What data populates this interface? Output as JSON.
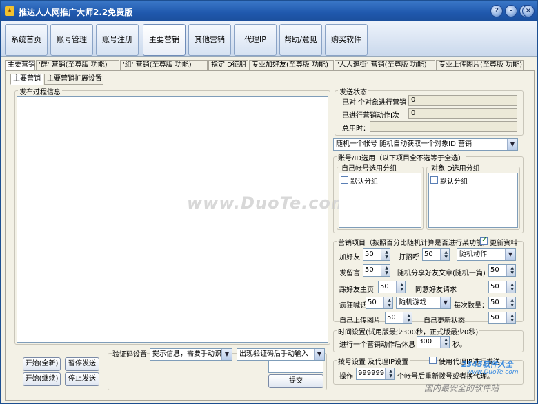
{
  "window": {
    "title": "推达人人网推广大师2.2免费版",
    "icon": "app-icon"
  },
  "window_buttons": [
    "help-icon",
    "minimize-icon",
    "maximize-icon",
    "close-icon"
  ],
  "nav": [
    "系统首页",
    "账号管理",
    "账号注册",
    "主要营销",
    "其他营销",
    "代理IP",
    "帮助/意见",
    "购买软件"
  ],
  "subtabs": [
    "主要营销",
    "'群' 营销(至尊版 功能)",
    "'组' 营销(至尊版 功能)",
    "指定ID征朋",
    "专业加好友(至尊版 功能)",
    "'人人逛街' 营销(至尊版 功能)",
    "专业上传图片(至尊版 功能)"
  ],
  "subtabs2": [
    "主要营销",
    "主要营销扩展设置"
  ],
  "log": {
    "title": "发布过程信息"
  },
  "buttons": {
    "start_new": "开始(全新)",
    "pause": "暂停发送",
    "start_continue": "开始(继续)",
    "stop": "停止发送",
    "submit": "提交"
  },
  "captcha": {
    "label": "验证码设置",
    "mode": "提示信息，需要手动识",
    "mode2": "出现验证码后手动输入"
  },
  "status": {
    "title": "发送状态",
    "done_objects_label": "已对I个对象进行营销",
    "done_objects": "0",
    "done_actions_label": "已进行营销动作I次",
    "done_actions": "0",
    "total_time_label": "总用时："
  },
  "account_mode": {
    "value": "随机一个帐号    随机自动获取一个对象ID 营销"
  },
  "grouping": {
    "title": "账号/ID选用（以下项目全不选等于全选）",
    "left_title": "自己帐号选用分组",
    "right_title": "对象ID选用分组",
    "left_item": "默认分组",
    "right_item": "默认分组"
  },
  "marketing": {
    "title": "营销项目（按照百分比随机计算是否进行某功能）",
    "refresh_label": "更新资料",
    "add_friend_label": "加好友",
    "add_friend": "50",
    "greet_label": "打招呼",
    "greet": "50",
    "random_action": "随机动作",
    "leave_msg_label": "发留言",
    "leave_msg": "50",
    "share_label": "随机分享好友文章(随机一篇)",
    "share": "50",
    "visit_label": "踩好友主页",
    "visit": "50",
    "accept_label": "同意好友请求",
    "accept": "50",
    "shout_label": "疯狂喊话",
    "shout": "50",
    "game": "随机游戏",
    "count_label": "每次数量：",
    "count": "50",
    "upload_label": "自己上传图片",
    "upload": "50",
    "update_label": "自己更新状态",
    "update": "50"
  },
  "time": {
    "title": "时间设置(试用版最少300秒，正式版最少0秒)",
    "rest_label": "进行一个营销动作后休息",
    "rest": "300",
    "unit": "秒。"
  },
  "dial": {
    "title": "拨号设置 及代理IP设置",
    "proxy_label": "使用代理IP进行发送",
    "op_label": "操作",
    "op_value": "999999",
    "op_suffix": "个帐号后重新拨号或者换代理。"
  },
  "watermark": {
    "main": "www.DuoTe.com",
    "site": "2345软件大全",
    "site2": "www.DuoTe.com",
    "slogan": "国内最安全的软件站"
  }
}
